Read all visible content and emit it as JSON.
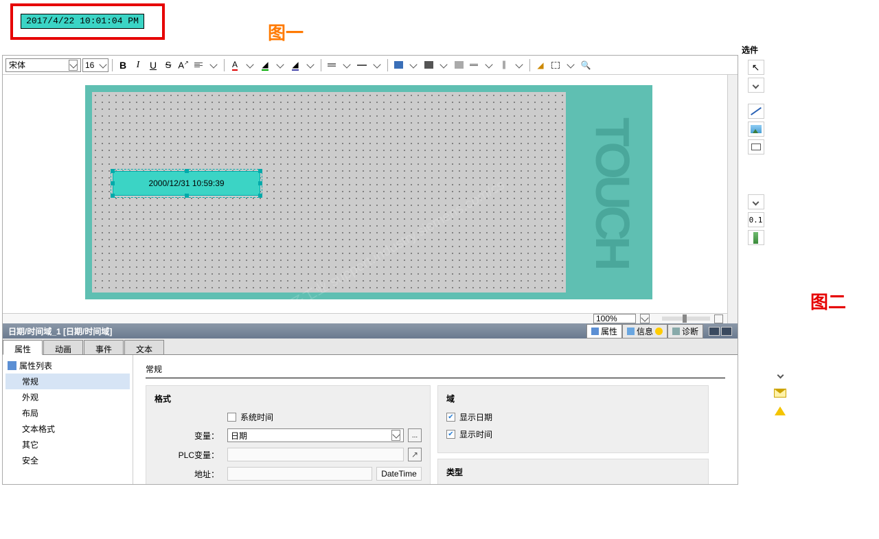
{
  "figure_labels": {
    "fig1": "图一",
    "fig2": "图二"
  },
  "preview": {
    "datetime": "2017/4/22 10:01:04 PM"
  },
  "toolbar": {
    "font_name": "宋体",
    "font_size": "16"
  },
  "canvas": {
    "touch_label": "TOUCH",
    "widget_text": "2000/12/31 10:59:39",
    "zoom": "100%",
    "watermark": "找答案\n西门子工业\nsupport.industry.siemens.com/cs"
  },
  "inspector": {
    "title": "日期/时间域_1 [日期/时间域]",
    "title_tabs": {
      "props": "属性",
      "info": "信息",
      "diag": "诊断"
    },
    "tabs": [
      "属性",
      "动画",
      "事件",
      "文本"
    ],
    "tree_header": "属性列表",
    "tree": [
      "常规",
      "外观",
      "布局",
      "文本格式",
      "其它",
      "安全"
    ],
    "section_general": "常规",
    "panel_format": {
      "title": "格式",
      "sys_time": "系统时间",
      "var_label": "变量：",
      "var_value": "日期",
      "plc_label": "PLC变量：",
      "addr_label": "地址：",
      "addr_type": "DateTime"
    },
    "panel_domain": {
      "title": "域",
      "show_date": "显示日期",
      "show_time": "显示时间",
      "type_title": "类型"
    }
  },
  "sidepanel": {
    "header": "选件"
  }
}
